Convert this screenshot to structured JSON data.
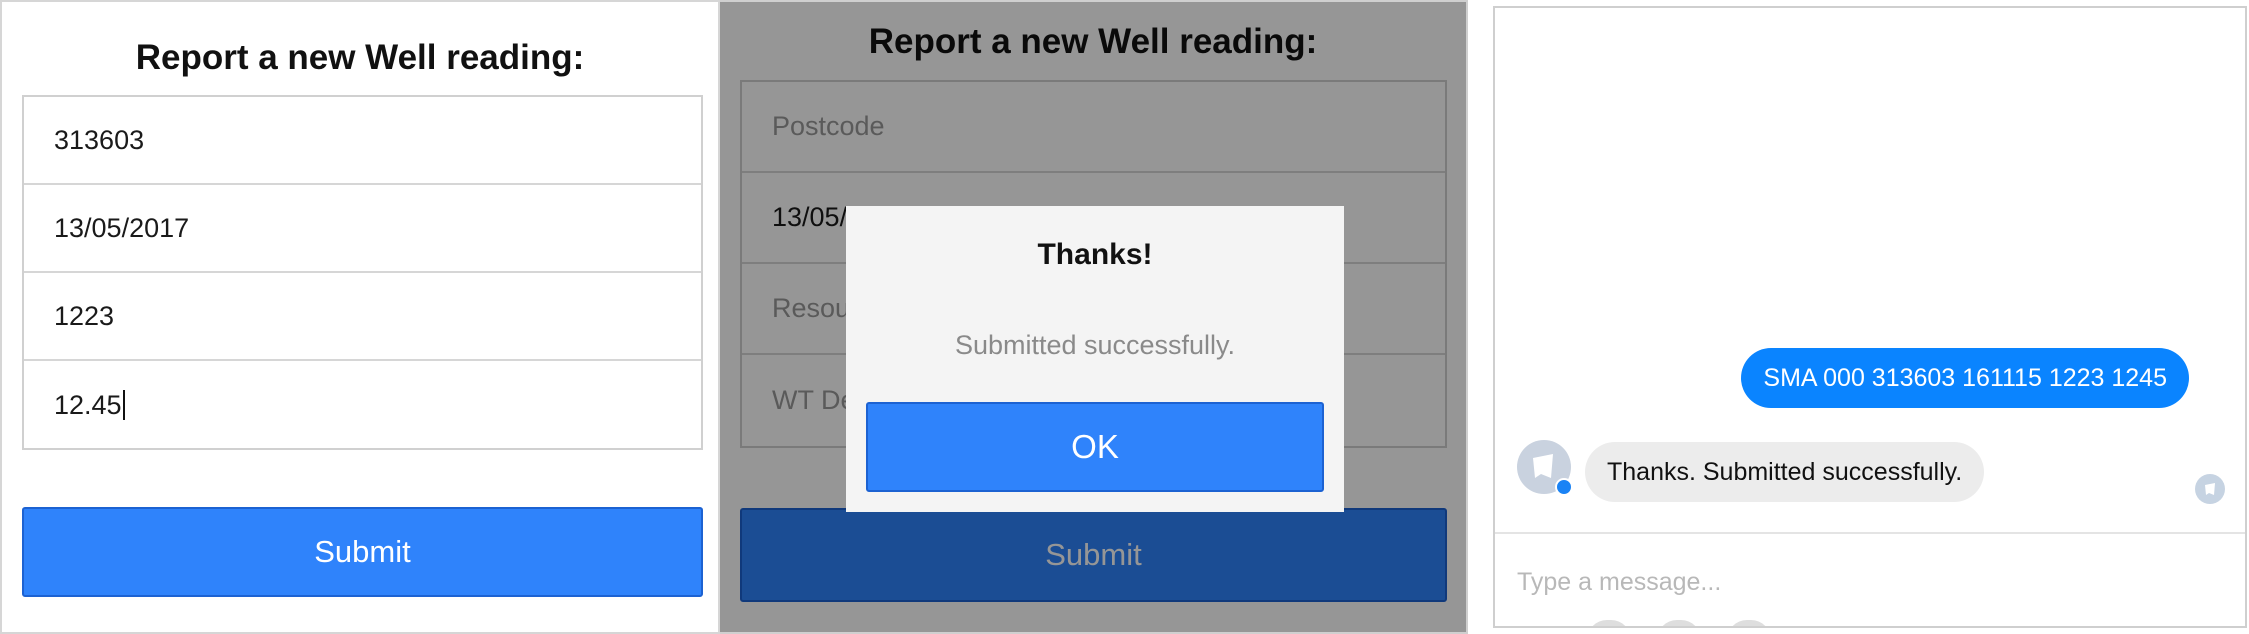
{
  "form": {
    "title": "Report a new Well reading:",
    "submit_label": "Submit"
  },
  "panel1": {
    "fields": [
      {
        "value": "313603"
      },
      {
        "value": "13/05/2017"
      },
      {
        "value": "1223"
      },
      {
        "value": "12.45"
      }
    ]
  },
  "panel2": {
    "fields": [
      {
        "placeholder": "Postcode"
      },
      {
        "value": "13/05/2017"
      },
      {
        "placeholder": "Resource ID"
      },
      {
        "placeholder": "WT Depth (m)"
      }
    ],
    "dialog": {
      "title": "Thanks!",
      "message": "Submitted successfully.",
      "ok_label": "OK"
    }
  },
  "chat": {
    "outgoing_message": "SMA 000 313603 161115 1223 1245",
    "incoming_message": "Thanks. Submitted successfully.",
    "input_placeholder": "Type a message..."
  },
  "colors": {
    "accent": "#2f83fb",
    "messenger_blue": "#0a84ff",
    "overlay": "#000000"
  }
}
